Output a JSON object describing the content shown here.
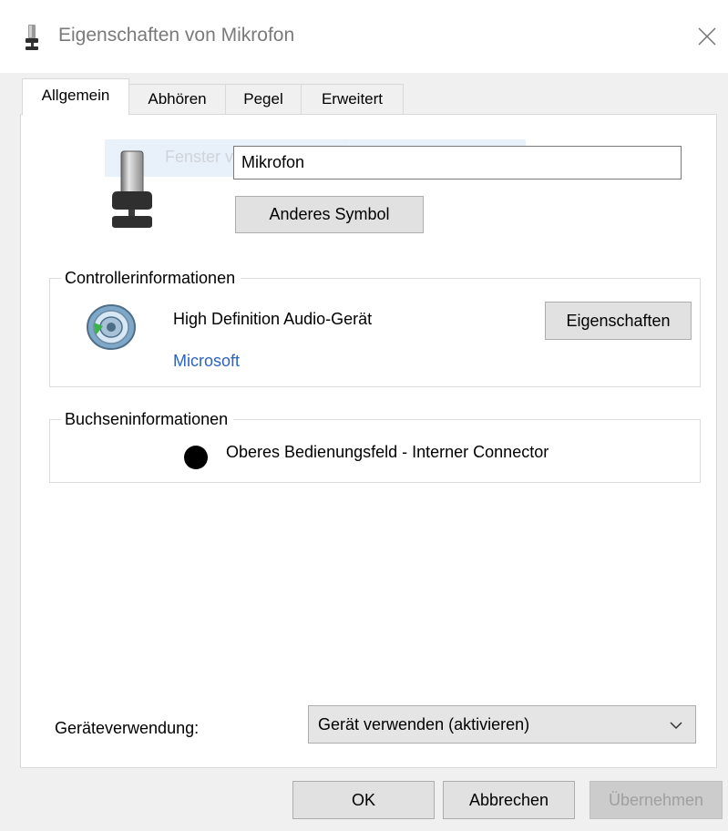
{
  "window": {
    "title": "Eigenschaften von Mikrofon",
    "title_icon": "microphone-icon",
    "close_icon": "close-icon"
  },
  "tabs": [
    {
      "label": "Allgemein",
      "active": true
    },
    {
      "label": "Abhören",
      "active": false
    },
    {
      "label": "Pegel",
      "active": false
    },
    {
      "label": "Erweitert",
      "active": false
    }
  ],
  "general": {
    "ghost_text": "Fenster verschieben",
    "device_name": "Mikrofon",
    "change_icon_button": "Anderes Symbol",
    "device_icon": "microphone-icon"
  },
  "controller": {
    "legend": "Controllerinformationen",
    "name": "High Definition Audio-Gerät",
    "vendor": "Microsoft",
    "properties_button": "Eigenschaften",
    "icon": "speaker-icon"
  },
  "jack": {
    "legend": "Buchseninformationen",
    "description": "Oberes Bedienungsfeld - Interner Connector",
    "jack_color": "#000000"
  },
  "usage": {
    "label": "Geräteverwendung:",
    "selected": "Gerät verwenden (aktivieren)"
  },
  "footer": {
    "ok": "OK",
    "cancel": "Abbrechen",
    "apply": "Übernehmen"
  },
  "colors": {
    "link": "#2b63c1",
    "panel_bg": "#ffffff",
    "dialog_bg": "#f0f0f0",
    "button_bg": "#e1e1e1"
  }
}
